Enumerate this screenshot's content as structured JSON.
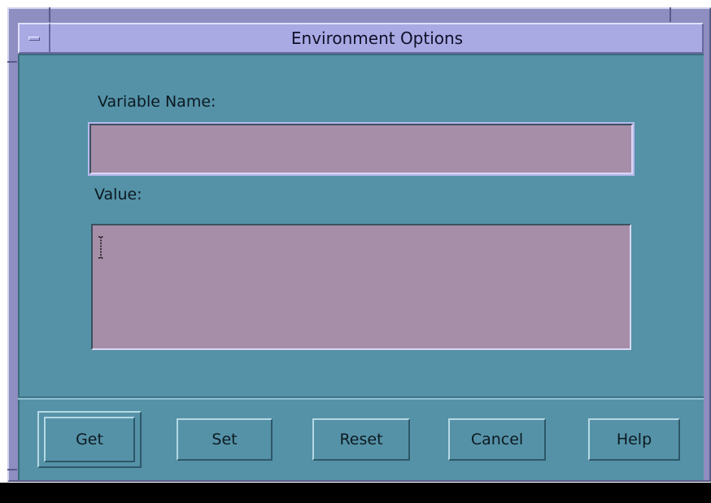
{
  "window": {
    "title": "Environment Options"
  },
  "form": {
    "variable_name_label": "Variable Name:",
    "variable_name_value": "",
    "value_label": "Value:",
    "value_value": ""
  },
  "buttons": {
    "get": "Get",
    "set": "Set",
    "reset": "Reset",
    "cancel": "Cancel",
    "help": "Help"
  },
  "colors": {
    "client_background": "#5592a8",
    "field_background": "#a68da8",
    "titlebar": "#a9a9e4"
  },
  "icons": {
    "window_menu": "window-menu-icon",
    "text_cursor": "text-cursor-icon"
  }
}
